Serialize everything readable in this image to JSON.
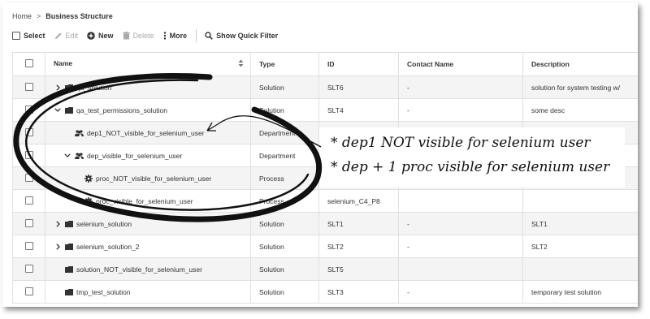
{
  "breadcrumb": {
    "home": "Home",
    "separator": ">",
    "current": "Business Structure"
  },
  "toolbar": {
    "select": "Select",
    "edit": "Edit",
    "new": "New",
    "delete": "Delete",
    "more": "More",
    "quick_filter": "Show Quick Filter"
  },
  "table": {
    "headers": {
      "name": "Name",
      "type": "Type",
      "id": "ID",
      "contact": "Contact Name",
      "description": "Description"
    },
    "rows": [
      {
        "name": "qa_solution",
        "type": "Solution",
        "id": "SLT6",
        "contact": "-",
        "description": "solution for system testing w/",
        "icon": "folder-icon",
        "chevron": "right",
        "indent": 0
      },
      {
        "name": "qa_test_permissions_solution",
        "type": "Solution",
        "id": "SLT4",
        "contact": "-",
        "description": "some desc",
        "icon": "folder-icon",
        "chevron": "down",
        "indent": 0
      },
      {
        "name": "dep1_NOT_visible_for_selenium_user",
        "type": "Department",
        "id": "",
        "contact": "",
        "description": "",
        "icon": "people-icon",
        "chevron": "none",
        "indent": 1
      },
      {
        "name": "dep_visible_for_selenium_user",
        "type": "Department",
        "id": "",
        "contact": "",
        "description": "",
        "icon": "people-icon",
        "chevron": "down",
        "indent": 1
      },
      {
        "name": "proc_NOT_visible_for_selenium_user",
        "type": "Process",
        "id": "",
        "contact": "",
        "description": "",
        "icon": "gear-icon",
        "chevron": "none",
        "indent": 2
      },
      {
        "name": "proc_visible_for_selenium_user",
        "type": "Process",
        "id": "selenium_C4_P8",
        "contact": "",
        "description": "",
        "icon": "gear-icon",
        "chevron": "none",
        "indent": 2
      },
      {
        "name": "selenium_solution",
        "type": "Solution",
        "id": "SLT1",
        "contact": "-",
        "description": "SLT1",
        "icon": "folder-icon",
        "chevron": "right",
        "indent": 0
      },
      {
        "name": "selenium_solution_2",
        "type": "Solution",
        "id": "SLT2",
        "contact": "-",
        "description": "SLT2",
        "icon": "folder-icon",
        "chevron": "right",
        "indent": 0
      },
      {
        "name": "solution_NOT_visible_for_selenium_user",
        "type": "Solution",
        "id": "SLT5",
        "contact": "",
        "description": "",
        "icon": "folder-icon",
        "chevron": "none",
        "indent": 0
      },
      {
        "name": "tmp_test_solution",
        "type": "Solution",
        "id": "SLT3",
        "contact": "-",
        "description": "temporary test solution",
        "icon": "folder-icon",
        "chevron": "none",
        "indent": 0
      }
    ]
  },
  "annotation": {
    "line1": "* dep1 NOT visible for selenium user",
    "line2": "* dep + 1 proc visible for selenium user"
  }
}
